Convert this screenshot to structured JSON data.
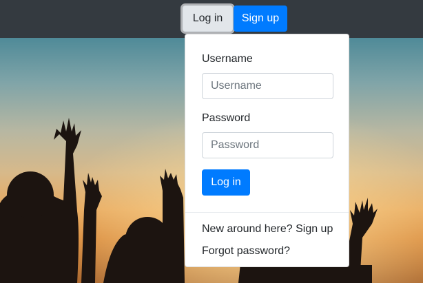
{
  "navbar": {
    "login_toggle_label": "Log in",
    "signup_label": "Sign up"
  },
  "dropdown": {
    "username_label": "Username",
    "username_placeholder": "Username",
    "username_value": "",
    "password_label": "Password",
    "password_placeholder": "Password",
    "password_value": "",
    "submit_label": "Log in",
    "signup_link": "New around here? Sign up",
    "forgot_link": "Forgot password?"
  },
  "colors": {
    "navbar_bg": "#343a40",
    "primary": "#007bff",
    "toggle_bg": "#e2e6ea"
  }
}
